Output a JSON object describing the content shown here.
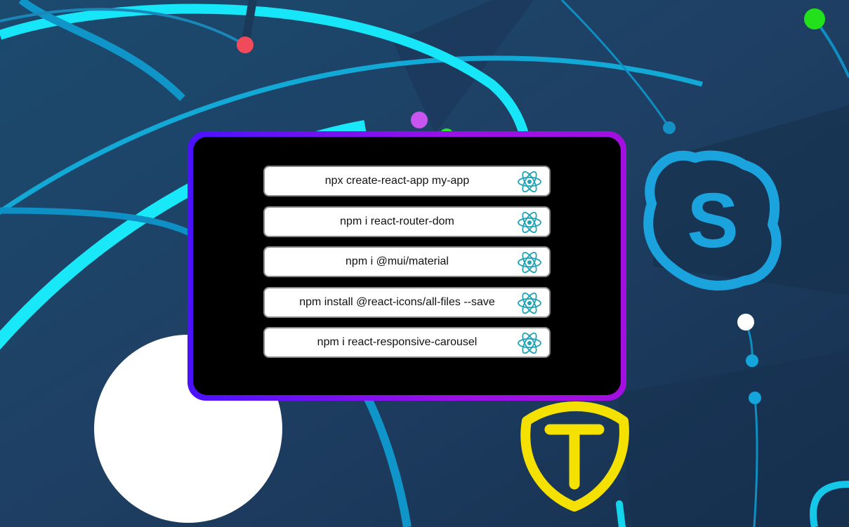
{
  "commands": [
    {
      "text": "npx create-react-app my-app",
      "icon": "react-icon"
    },
    {
      "text": "npm i react-router-dom",
      "icon": "react-icon"
    },
    {
      "text": "npm i @mui/material",
      "icon": "react-icon"
    },
    {
      "text": "npm install @react-icons/all-files --save",
      "icon": "react-icon"
    },
    {
      "text": "npm i react-responsive-carousel",
      "icon": "react-icon"
    }
  ],
  "background": {
    "base_color": "#1d3b5c",
    "skype_letter": "S",
    "badge_letter": "T"
  },
  "colors": {
    "frame_gradient_start": "#4a12ff",
    "frame_gradient_end": "#a20fe0",
    "react_teal": "#1fa3b5",
    "skype_blue": "#1aa3dc",
    "badge_yellow": "#f4e100"
  }
}
